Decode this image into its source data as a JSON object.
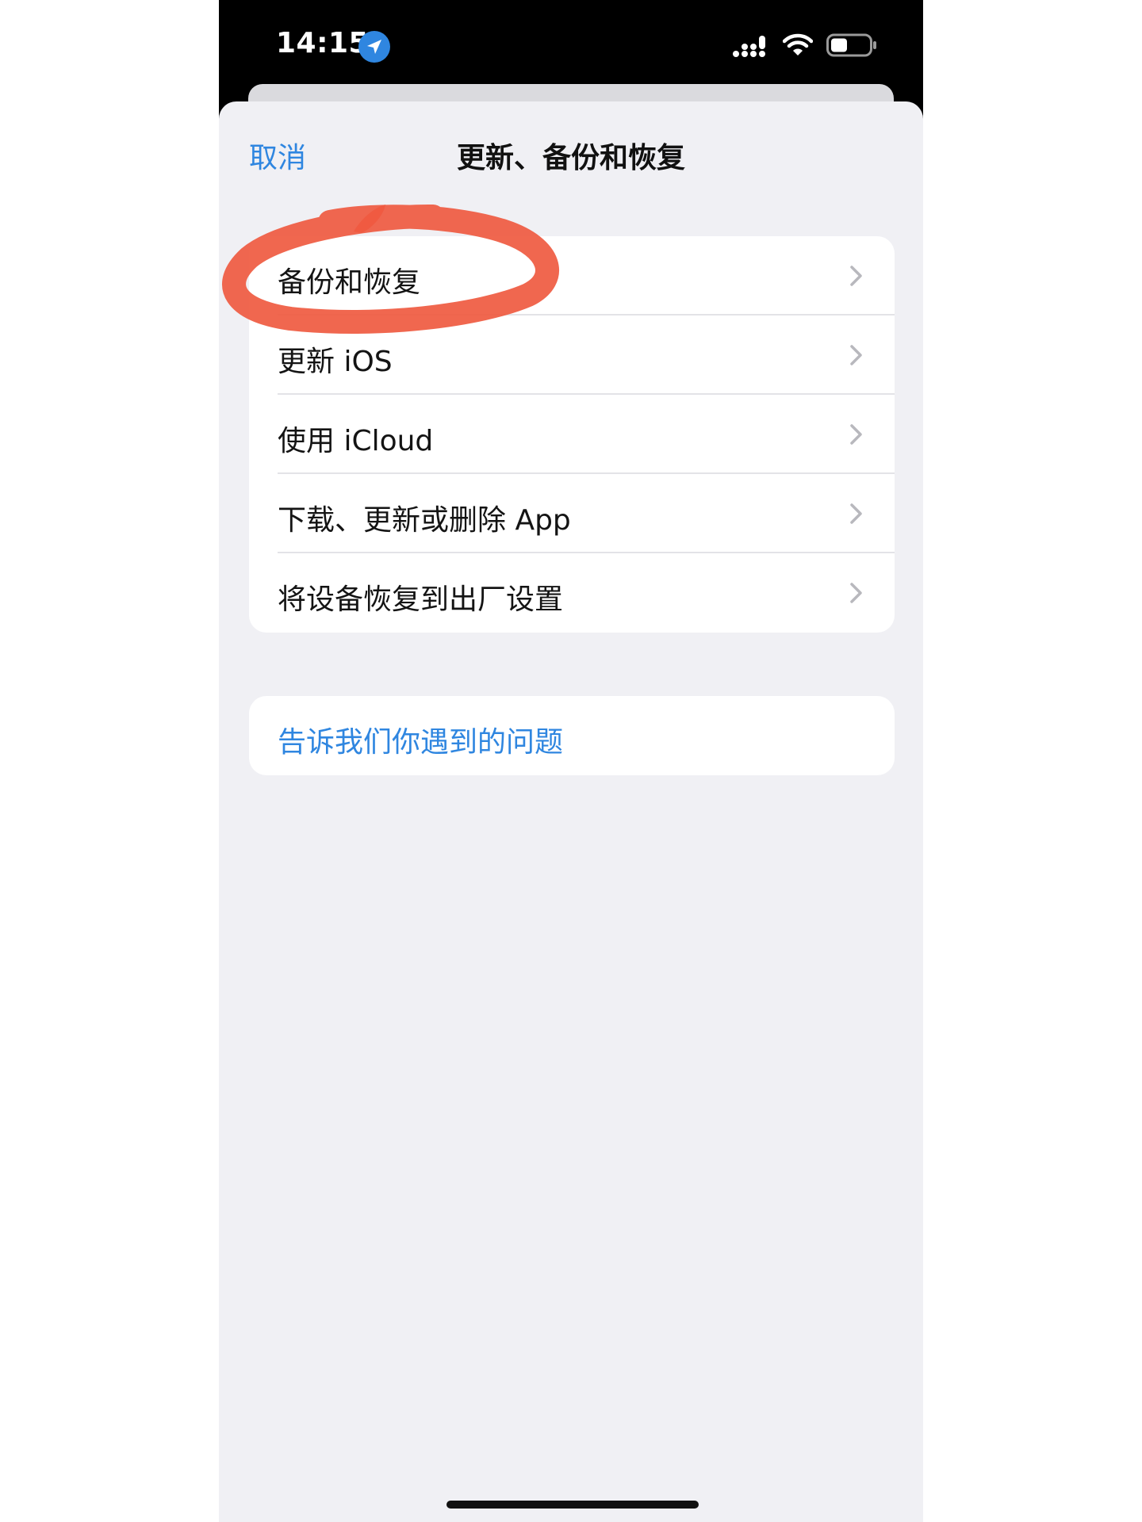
{
  "status_bar": {
    "time": "14:15",
    "icons": [
      "location-arrow-icon",
      "cellular-signal-icon",
      "wifi-icon",
      "battery-icon"
    ]
  },
  "nav": {
    "cancel_label": "取消",
    "title": "更新、备份和恢复"
  },
  "menu": {
    "items": [
      {
        "label": "备份和恢复",
        "icon": "chevron-right-icon"
      },
      {
        "label": "更新 iOS",
        "icon": "chevron-right-icon"
      },
      {
        "label": "使用 iCloud",
        "icon": "chevron-right-icon"
      },
      {
        "label": "下载、更新或删除 App",
        "icon": "chevron-right-icon"
      },
      {
        "label": "将设备恢复到出厂设置",
        "icon": "chevron-right-icon"
      }
    ]
  },
  "feedback": {
    "label": "告诉我们你遇到的问题"
  },
  "colors": {
    "accent": "#2f86e0",
    "sheet_background": "#f0f0f4",
    "annotation": "#ef5a40"
  }
}
